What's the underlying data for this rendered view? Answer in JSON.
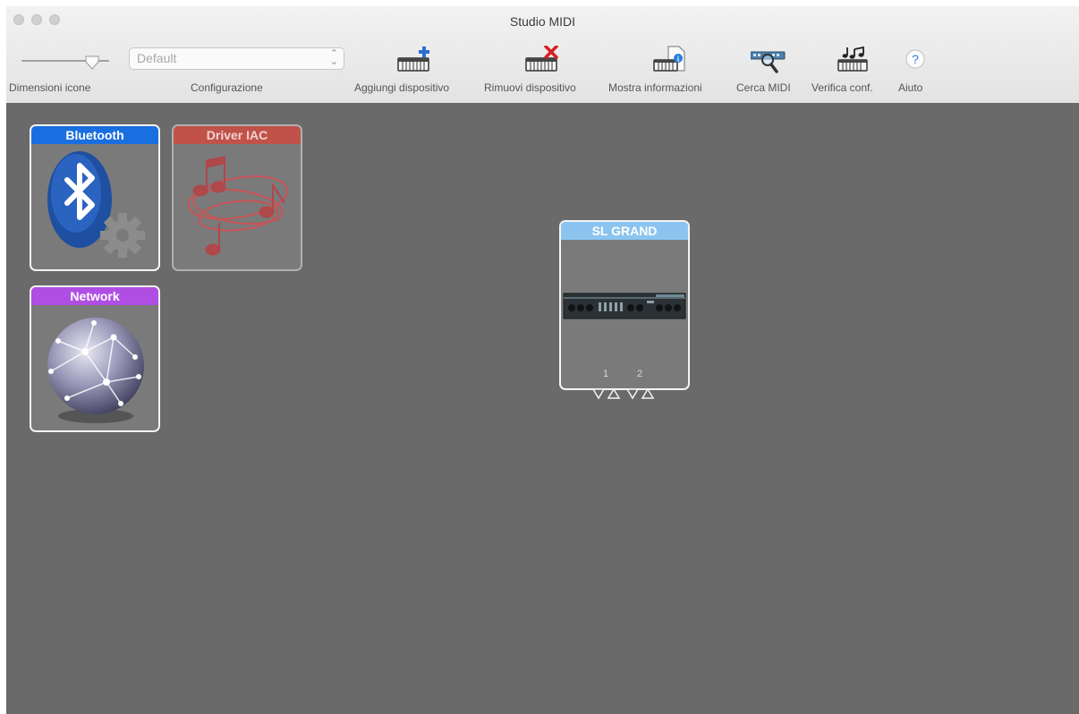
{
  "window": {
    "title": "Studio MIDI"
  },
  "toolbar": {
    "icon_size_label": "Dimensioni icone",
    "config_label": "Configurazione",
    "config_value": "Default",
    "items": [
      {
        "label": "Aggiungi dispositivo",
        "icon": "add-device-icon"
      },
      {
        "label": "Rimuovi dispositivo",
        "icon": "remove-device-icon"
      },
      {
        "label": "Mostra informazioni",
        "icon": "info-icon"
      },
      {
        "label": "Cerca MIDI",
        "icon": "search-midi-icon"
      },
      {
        "label": "Verifica conf.",
        "icon": "test-setup-icon"
      },
      {
        "label": "Aiuto",
        "icon": "help-icon"
      }
    ]
  },
  "devices": [
    {
      "name": "Bluetooth",
      "header_color": "#1a6fe0",
      "icon": "bluetooth-icon"
    },
    {
      "name": "Driver IAC",
      "header_color": "#c0524a",
      "icon": "midi-notes-icon",
      "dimmed": true
    },
    {
      "name": "Network",
      "header_color": "#b04ee4",
      "icon": "network-globe-icon"
    },
    {
      "name": "SL GRAND",
      "header_color": "#8cc4f0",
      "icon": "sl-grand-device-icon",
      "ports": [
        "1",
        "2"
      ]
    }
  ]
}
